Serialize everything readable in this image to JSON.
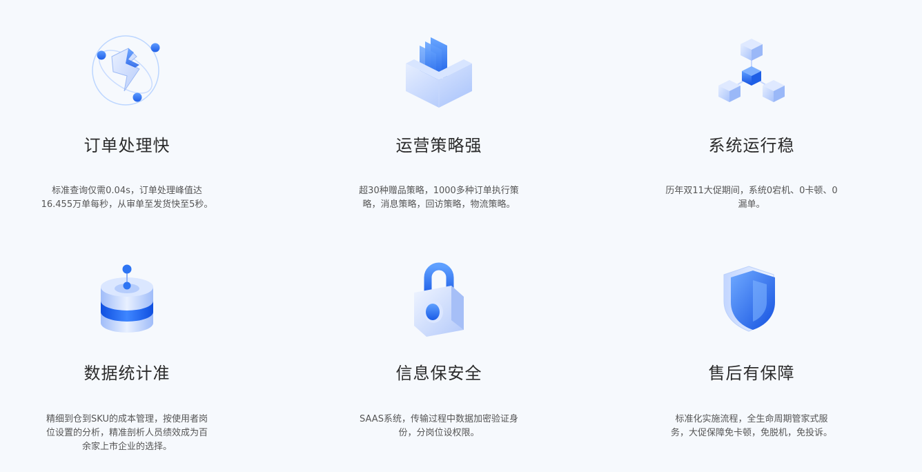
{
  "features": [
    {
      "title": "订单处理快",
      "desc_lines": [
        "标准查询仅需0.04s，订单处理峰值达",
        "16.455万单每秒，从审单至发货快至5秒。"
      ],
      "icon": "lightning-orbit-icon"
    },
    {
      "title": "运营策略强",
      "desc_lines": [
        "超30种赠品策略，1000多种订单执行策",
        "略，消息策略，回访策略，物流策略。"
      ],
      "icon": "strategy-box-icon"
    },
    {
      "title": "系统运行稳",
      "desc_lines": [
        "历年双11大促期间，系统0宕机、0卡顿、0",
        "漏单。"
      ],
      "icon": "cube-network-icon"
    },
    {
      "title": "数据统计准",
      "desc_lines": [
        "精细到仓到SKU的成本管理，按使用者岗",
        "位设置的分析，精准剖析人员绩效成为百",
        "余家上市企业的选择。"
      ],
      "icon": "database-icon"
    },
    {
      "title": "信息保安全",
      "desc_lines": [
        "SAAS系统，传输过程中数据加密验证身",
        "份，分岗位设权限。"
      ],
      "icon": "padlock-icon"
    },
    {
      "title": "售后有保障",
      "desc_lines": [
        "标准化实施流程，全生命周期管家式服",
        "务，大促保障免卡顿，免脱机，免投诉。"
      ],
      "icon": "shield-icon"
    }
  ],
  "colors": {
    "background": "#f6f9fd",
    "accent": "#2f7bf6",
    "accent_light": "#bcd3ff"
  }
}
